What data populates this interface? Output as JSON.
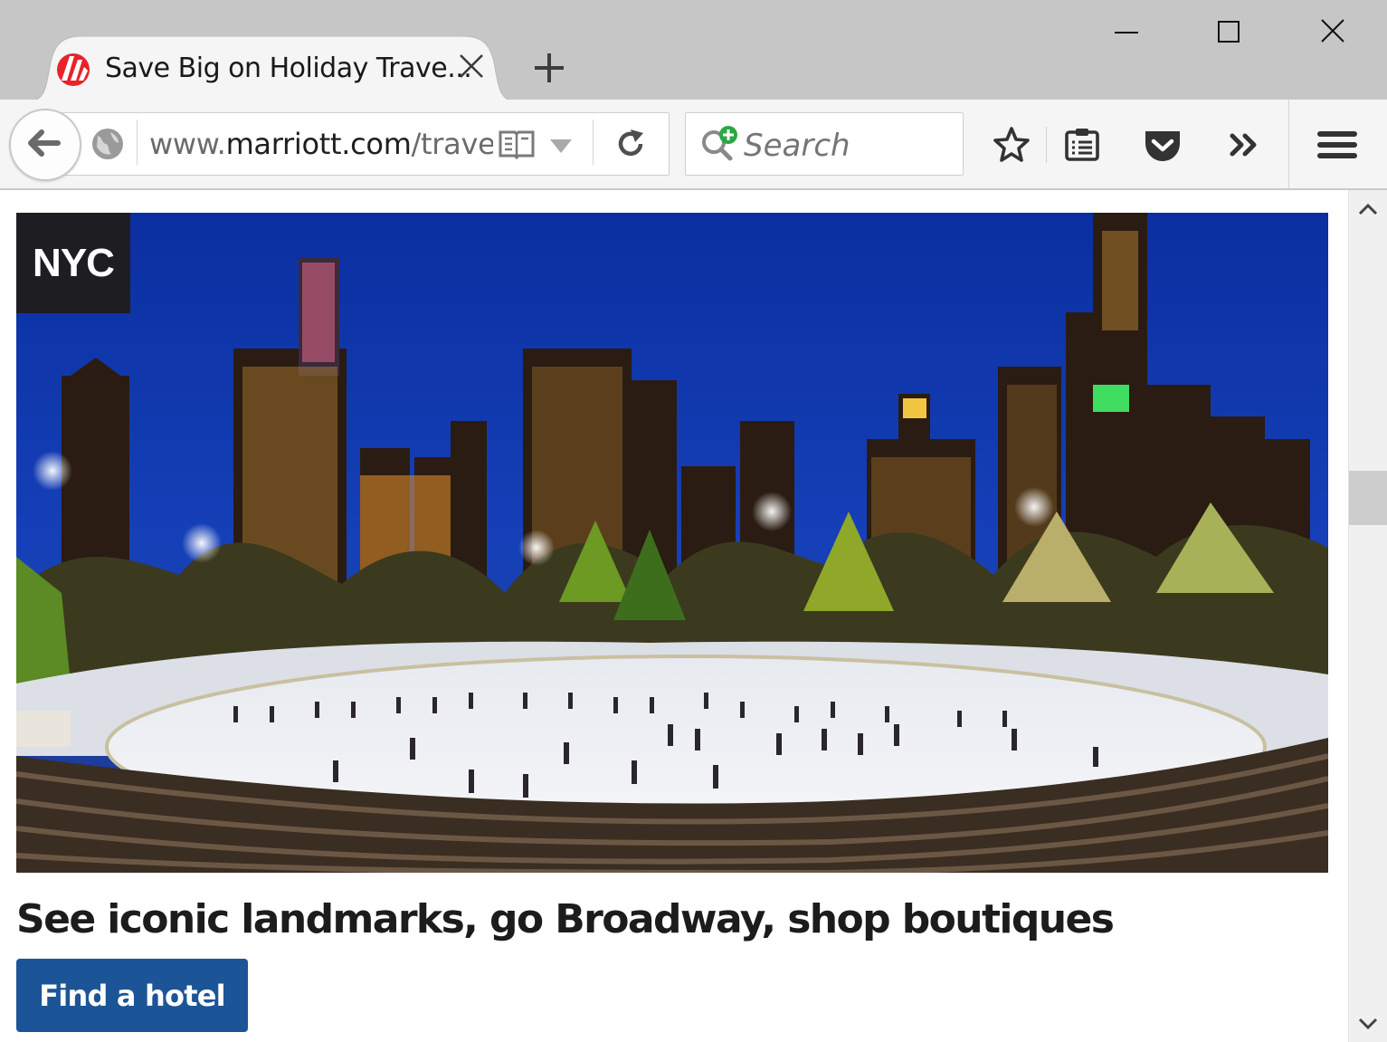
{
  "window": {
    "minimize_icon": "minimize-icon",
    "maximize_icon": "maximize-icon",
    "close_icon": "close-icon"
  },
  "tab": {
    "title": "Save Big on Holiday Trave...",
    "favicon": "marriott-logo-icon",
    "close_icon": "close-icon"
  },
  "new_tab_icon": "plus-icon",
  "toolbar": {
    "url_prefix": "www.",
    "url_host": "marriott.com",
    "url_path": "/trave",
    "search_placeholder": "Search"
  },
  "page": {
    "hero_badge": "NYC",
    "headline": "See iconic landmarks, go Broadway, shop boutiques",
    "cta_label": "Find a hotel"
  },
  "colors": {
    "cta_background": "#1c5597",
    "badge_background": "#1e1e22",
    "tab_strip": "#c6c6c6",
    "toolbar": "#f5f5f5",
    "favicon_red": "#e8242a"
  }
}
